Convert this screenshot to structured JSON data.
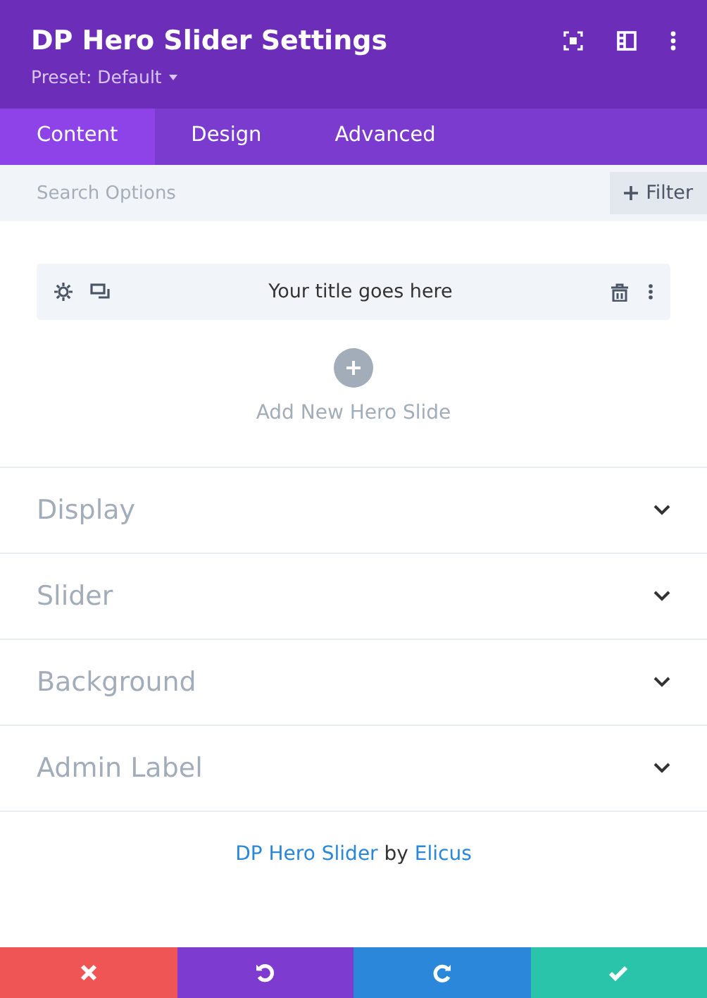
{
  "header": {
    "title": "DP Hero Slider Settings",
    "preset": "Preset: Default"
  },
  "tabs": [
    {
      "label": "Content",
      "selected": true
    },
    {
      "label": "Design",
      "selected": false
    },
    {
      "label": "Advanced",
      "selected": false
    }
  ],
  "search": {
    "placeholder": "Search Options",
    "filter_button": "Filter"
  },
  "slides": [
    {
      "title": "Your title goes here"
    }
  ],
  "add_slide": "Add New Hero Slide",
  "sections": [
    {
      "label": "Display",
      "expanded": false
    },
    {
      "label": "Slider",
      "expanded": false
    },
    {
      "label": "Background",
      "expanded": false
    },
    {
      "label": "Admin Label",
      "expanded": false
    }
  ],
  "credit": {
    "product": "DP Hero Slider",
    "by": "by",
    "author": "Elicus"
  },
  "action_bar": [
    {
      "kind": "cancel"
    },
    {
      "kind": "undo"
    },
    {
      "kind": "redo"
    },
    {
      "kind": "save"
    }
  ]
}
